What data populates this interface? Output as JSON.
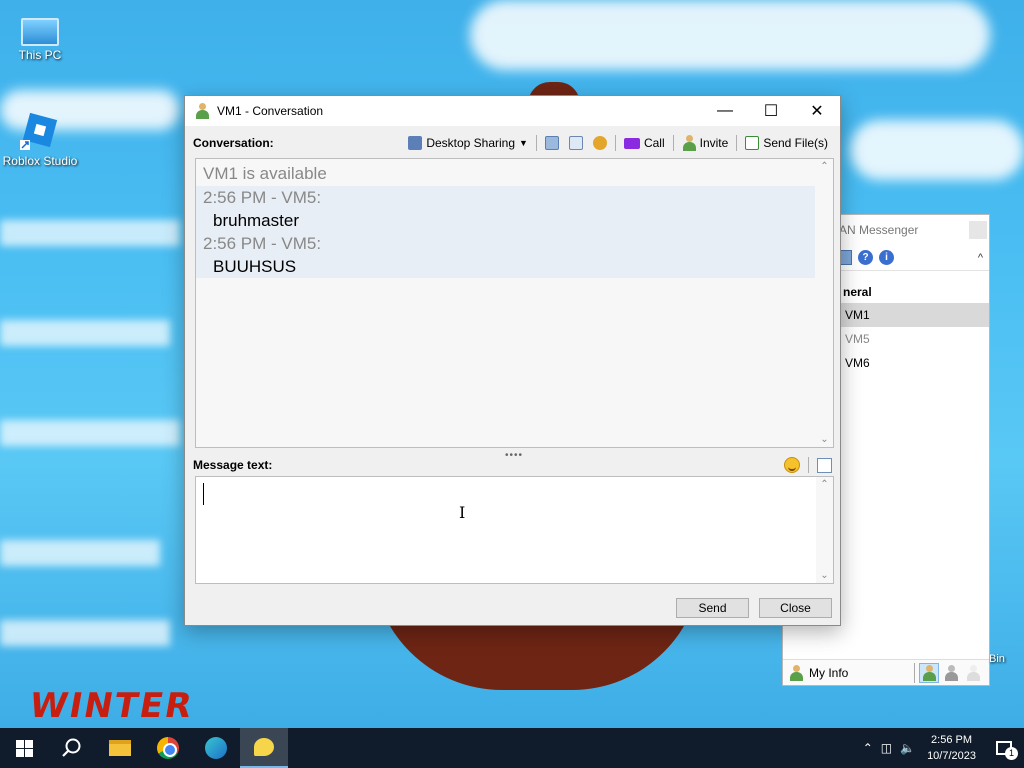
{
  "desktop": {
    "icons": [
      {
        "label": "This PC"
      },
      {
        "label": "Roblox Studio"
      }
    ],
    "recycle_bin_label": "Bin",
    "art_text": "WINTER"
  },
  "messenger": {
    "title": "AN Messenger",
    "group": "neral",
    "users": [
      {
        "name": "VM1",
        "state": "selected"
      },
      {
        "name": "VM5",
        "state": "offline"
      },
      {
        "name": "VM6",
        "state": "online"
      }
    ],
    "footer_label": "My Info"
  },
  "conversation": {
    "window_title": "VM1 - Conversation",
    "conversation_label": "Conversation:",
    "toolbar": {
      "desktop_sharing": "Desktop Sharing",
      "call": "Call",
      "invite": "Invite",
      "send_files": "Send File(s)"
    },
    "status_line": "VM1 is available",
    "messages": [
      {
        "header": "2:56 PM - VM5:",
        "text": "bruhmaster"
      },
      {
        "header": "2:56 PM - VM5:",
        "text": "BUUHSUS"
      }
    ],
    "message_label": "Message text:",
    "input_value": "",
    "send_label": "Send",
    "close_label": "Close"
  },
  "taskbar": {
    "time": "2:56 PM",
    "date": "10/7/2023",
    "notification_count": "1"
  },
  "colors": {
    "desktop": "#49bdf2",
    "taskbar": "#101c2b",
    "message_block": "#e8eef6",
    "header_text": "#888888"
  }
}
